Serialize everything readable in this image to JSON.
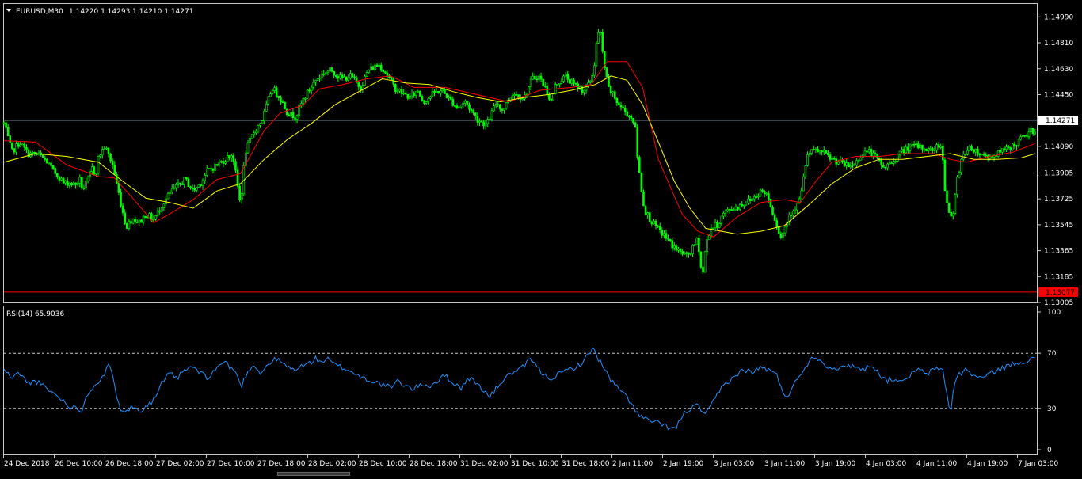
{
  "main_label": {
    "symbol": "EURUSD,M30",
    "ohlc": "1.14220 1.14293 1.14210 1.14271"
  },
  "rsi_label": "RSI(14) 65.9036",
  "colors": {
    "background": "#000000",
    "frame": "#c8c8c8",
    "candle": "#00ff00",
    "ma_fast": "#ff0000",
    "ma_slow": "#ffff00",
    "rsi": "#1e90ff",
    "bid_line": "#708090",
    "low_line": "#ff0000",
    "low_tag": "#ff0000"
  },
  "chart_data": [
    {
      "type": "candlestick",
      "symbol": "EURUSD",
      "timeframe": "M30",
      "ylim": [
        1.13005,
        1.1508
      ],
      "y_ticks": [
        "1.14990",
        "1.14810",
        "1.14630",
        "1.14450",
        "1.14271",
        "1.14090",
        "1.13905",
        "1.13725",
        "1.13545",
        "1.13365",
        "1.13185",
        "1.13005"
      ],
      "y_tick_values": [
        1.1499,
        1.1481,
        1.1463,
        1.1445,
        1.14271,
        1.1409,
        1.13905,
        1.13725,
        1.13545,
        1.13365,
        1.13185,
        1.13005
      ],
      "current_price": 1.14271,
      "current_price_label": "1.14271",
      "low_line_price": 1.13077,
      "low_line_label": "1.13077",
      "x_ticks": [
        "24 Dec 2018",
        "26 Dec 10:00",
        "26 Dec 18:00",
        "27 Dec 02:00",
        "27 Dec 10:00",
        "27 Dec 18:00",
        "28 Dec 02:00",
        "28 Dec 10:00",
        "28 Dec 18:00",
        "31 Dec 02:00",
        "31 Dec 10:00",
        "31 Dec 18:00",
        "2 Jan 11:00",
        "2 Jan 19:00",
        "3 Jan 03:00",
        "3 Jan 11:00",
        "3 Jan 19:00",
        "4 Jan 03:00",
        "4 Jan 11:00",
        "4 Jan 19:00",
        "7 Jan 03:00"
      ],
      "close_path": {
        "x": [
          0,
          10,
          20,
          30,
          45,
          55,
          62,
          70,
          76,
          82,
          90,
          96,
          100,
          106,
          112,
          116,
          120,
          128,
          138,
          150,
          155,
          163,
          172,
          180,
          190,
          200,
          205,
          212,
          220,
          230,
          240,
          250,
          258,
          270,
          285,
          290,
          300,
          306,
          316,
          328,
          340,
          350,
          360,
          370,
          380,
          395,
          405,
          415,
          428,
          440,
          452,
          462,
          475,
          485,
          495,
          505,
          515,
          525,
          532,
          545,
          555,
          565,
          575,
          585,
          600,
          612,
          625,
          632,
          645,
          660,
          670,
          678,
          688,
          694,
          700,
          712,
          722,
          735,
          742,
          748,
          752,
          756,
          760,
          766,
          772,
          780,
          790,
          800,
          804,
          812,
          820,
          828,
          836,
          848,
          856,
          866,
          872,
          880,
          884,
          886,
          890,
          896,
          906,
          912,
          920,
          930,
          940,
          950,
          960,
          968,
          974,
          980,
          985,
          990,
          996,
          1006,
          1012,
          1016,
          1020,
          1030,
          1040,
          1050,
          1060,
          1070,
          1080,
          1088,
          1096,
          1106,
          1116,
          1126,
          1136,
          1146,
          1156,
          1166,
          1176,
          1186,
          1190,
          1194,
          1198,
          1203,
          1208,
          1216,
          1228,
          1240,
          1252,
          1260,
          1272,
          1282,
          1292,
          1302,
          1308
        ],
        "y": [
          1.1425,
          1.1405,
          1.1412,
          1.1404,
          1.1403,
          1.1398,
          1.1392,
          1.1388,
          1.1383,
          1.1384,
          1.1382,
          1.1386,
          1.1379,
          1.1385,
          1.1394,
          1.1389,
          1.1402,
          1.1409,
          1.1396,
          1.1365,
          1.1353,
          1.1359,
          1.1356,
          1.1362,
          1.1358,
          1.1368,
          1.1372,
          1.1378,
          1.1381,
          1.1386,
          1.1378,
          1.1384,
          1.1392,
          1.1396,
          1.1402,
          1.1404,
          1.1368,
          1.1405,
          1.1418,
          1.1428,
          1.145,
          1.1443,
          1.1432,
          1.143,
          1.1442,
          1.1455,
          1.146,
          1.1462,
          1.1456,
          1.1458,
          1.145,
          1.1462,
          1.1466,
          1.146,
          1.145,
          1.1446,
          1.1443,
          1.1448,
          1.144,
          1.1446,
          1.1448,
          1.1442,
          1.1436,
          1.144,
          1.1428,
          1.1424,
          1.144,
          1.1434,
          1.1446,
          1.1443,
          1.1456,
          1.1458,
          1.1448,
          1.144,
          1.1452,
          1.1458,
          1.1452,
          1.1448,
          1.1452,
          1.1462,
          1.1484,
          1.149,
          1.147,
          1.145,
          1.1445,
          1.1438,
          1.1432,
          1.1426,
          1.1398,
          1.1365,
          1.1358,
          1.1352,
          1.1348,
          1.134,
          1.1336,
          1.1333,
          1.1336,
          1.1345,
          1.1325,
          1.1318,
          1.134,
          1.1352,
          1.1355,
          1.1362,
          1.1365,
          1.1367,
          1.137,
          1.1373,
          1.1378,
          1.1376,
          1.1365,
          1.1355,
          1.1345,
          1.1352,
          1.1362,
          1.1368,
          1.1378,
          1.1395,
          1.1404,
          1.1406,
          1.1404,
          1.14,
          1.1398,
          1.1395,
          1.1397,
          1.1404,
          1.1406,
          1.1401,
          1.1394,
          1.1398,
          1.1404,
          1.1408,
          1.1409,
          1.1408,
          1.1406,
          1.141,
          1.1408,
          1.1375,
          1.1365,
          1.1356,
          1.1384,
          1.1404,
          1.1408,
          1.1403,
          1.1402,
          1.1404,
          1.1407,
          1.141,
          1.1415,
          1.1419,
          1.1421,
          1.1427
        ]
      },
      "series": [
        {
          "indicator": "moving_average_fast",
          "color": "#ff0000",
          "x": [
            0,
            40,
            80,
            120,
            140,
            160,
            190,
            210,
            240,
            270,
            300,
            330,
            350,
            380,
            400,
            430,
            460,
            490,
            520,
            560,
            600,
            640,
            680,
            720,
            745,
            765,
            790,
            810,
            830,
            860,
            880,
            900,
            930,
            960,
            990,
            1010,
            1030,
            1050,
            1080,
            1110,
            1140,
            1180,
            1200,
            1220,
            1250,
            1280,
            1308
          ],
          "y": [
            1.1413,
            1.1412,
            1.1396,
            1.1388,
            1.1387,
            1.1375,
            1.1356,
            1.1362,
            1.1372,
            1.1386,
            1.139,
            1.142,
            1.1432,
            1.1438,
            1.1449,
            1.1452,
            1.1456,
            1.1458,
            1.145,
            1.145,
            1.1445,
            1.144,
            1.1448,
            1.145,
            1.1452,
            1.1468,
            1.1468,
            1.145,
            1.14,
            1.1362,
            1.135,
            1.1346,
            1.136,
            1.137,
            1.1372,
            1.137,
            1.1385,
            1.1398,
            1.1402,
            1.1402,
            1.1404,
            1.1404,
            1.14,
            1.1398,
            1.1402,
            1.1405,
            1.1411
          ]
        },
        {
          "indicator": "moving_average_slow",
          "color": "#ffff00",
          "x": [
            0,
            40,
            80,
            120,
            150,
            180,
            210,
            240,
            270,
            300,
            330,
            360,
            390,
            420,
            450,
            480,
            510,
            540,
            570,
            600,
            630,
            660,
            690,
            720,
            750,
            770,
            790,
            810,
            830,
            850,
            870,
            890,
            910,
            930,
            960,
            990,
            1020,
            1050,
            1080,
            1110,
            1140,
            1170,
            1200,
            1230,
            1260,
            1290,
            1308
          ],
          "y": [
            1.1398,
            1.1404,
            1.1402,
            1.1398,
            1.1385,
            1.1373,
            1.137,
            1.1366,
            1.1378,
            1.1383,
            1.14,
            1.1414,
            1.1425,
            1.1438,
            1.1447,
            1.1456,
            1.1453,
            1.1452,
            1.1447,
            1.1443,
            1.144,
            1.1443,
            1.1445,
            1.1448,
            1.1452,
            1.1458,
            1.1455,
            1.1438,
            1.1412,
            1.1385,
            1.1366,
            1.1352,
            1.135,
            1.1348,
            1.135,
            1.1354,
            1.1368,
            1.1383,
            1.1394,
            1.14,
            1.14,
            1.1402,
            1.1404,
            1.14,
            1.14,
            1.1401,
            1.1404
          ]
        }
      ]
    },
    {
      "type": "line",
      "indicator": "RSI(14)",
      "value": 65.9036,
      "ylim": [
        0,
        100
      ],
      "y_ticks": [
        "100",
        "70",
        "30",
        "0"
      ],
      "y_tick_values": [
        100,
        70,
        30,
        0
      ],
      "levels": [
        70,
        30
      ],
      "x": [
        0,
        10,
        20,
        30,
        40,
        50,
        60,
        70,
        80,
        90,
        100,
        104,
        110,
        120,
        128,
        133,
        138,
        143,
        148,
        155,
        165,
        172,
        180,
        190,
        200,
        210,
        220,
        230,
        240,
        250,
        260,
        270,
        280,
        290,
        296,
        300,
        310,
        318,
        325,
        335,
        345,
        355,
        365,
        375,
        385,
        395,
        405,
        410,
        418,
        428,
        436,
        446,
        456,
        466,
        476,
        486,
        492,
        500,
        510,
        520,
        530,
        540,
        550,
        560,
        570,
        580,
        590,
        600,
        610,
        616,
        625,
        635,
        645,
        655,
        665,
        670,
        675,
        685,
        695,
        705,
        715,
        725,
        735,
        742,
        748,
        752,
        760,
        770,
        780,
        790,
        800,
        806,
        815,
        825,
        835,
        845,
        852,
        858,
        865,
        872,
        880,
        886,
        890,
        900,
        910,
        920,
        930,
        940,
        950,
        960,
        970,
        980,
        986,
        992,
        1000,
        1010,
        1016,
        1022,
        1030,
        1040,
        1050,
        1060,
        1070,
        1080,
        1090,
        1100,
        1110,
        1120,
        1130,
        1140,
        1150,
        1160,
        1170,
        1180,
        1190,
        1196,
        1200,
        1206,
        1212,
        1220,
        1230,
        1240,
        1250,
        1260,
        1270,
        1280,
        1290,
        1300,
        1308
      ],
      "y": [
        58,
        52,
        56,
        48,
        50,
        46,
        42,
        38,
        33,
        30,
        29,
        38,
        44,
        50,
        55,
        62,
        52,
        40,
        30,
        29,
        31,
        28,
        32,
        36,
        48,
        55,
        52,
        58,
        60,
        55,
        52,
        60,
        64,
        58,
        55,
        45,
        58,
        62,
        55,
        62,
        66,
        62,
        58,
        60,
        62,
        66,
        64,
        66,
        62,
        60,
        58,
        55,
        52,
        50,
        48,
        46,
        45,
        50,
        46,
        44,
        48,
        46,
        50,
        54,
        48,
        45,
        52,
        48,
        42,
        38,
        45,
        52,
        56,
        58,
        64,
        66,
        60,
        54,
        52,
        55,
        58,
        60,
        64,
        70,
        74,
        68,
        60,
        50,
        44,
        38,
        30,
        24,
        22,
        20,
        18,
        16,
        15,
        22,
        28,
        30,
        32,
        28,
        25,
        35,
        45,
        50,
        55,
        58,
        56,
        60,
        58,
        54,
        45,
        38,
        45,
        55,
        60,
        65,
        68,
        62,
        60,
        58,
        62,
        60,
        58,
        62,
        55,
        50,
        52,
        48,
        55,
        58,
        55,
        58,
        60,
        40,
        26,
        50,
        55,
        58,
        54,
        52,
        55,
        58,
        60,
        62,
        64,
        65,
        66
      ]
    }
  ]
}
